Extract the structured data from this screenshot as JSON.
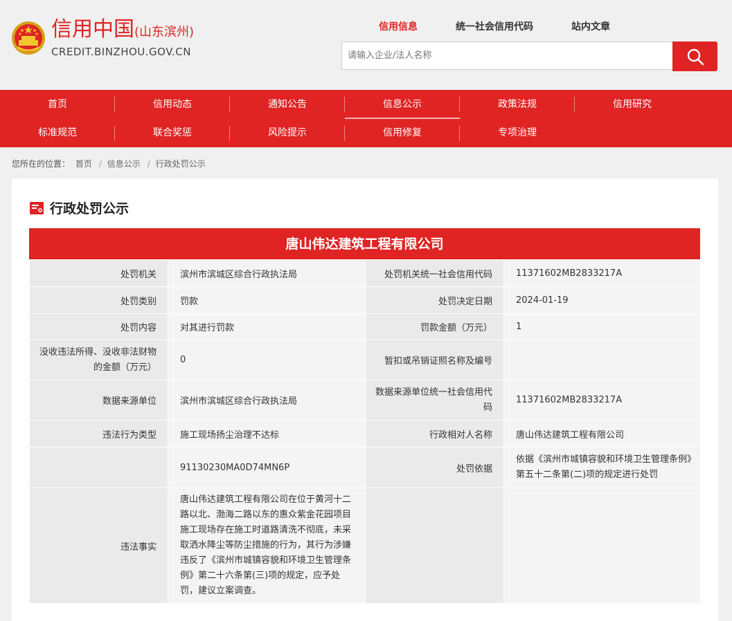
{
  "header": {
    "logo_main": "信用中国",
    "logo_region": "(山东滨州)",
    "logo_domain": "CREDIT.BINZHOU.GOV.CN",
    "top_tabs": [
      {
        "label": "信用信息",
        "active": true
      },
      {
        "label": "统一社会信用代码",
        "active": false
      },
      {
        "label": "站内文章",
        "active": false
      }
    ],
    "search_placeholder": "请输入企业/法人名称"
  },
  "nav": {
    "row1": [
      "首页",
      "信用动态",
      "通知公告",
      "信息公示",
      "政策法规",
      "信用研究"
    ],
    "row2": [
      "标准规范",
      "联合奖惩",
      "风险提示",
      "信用修复",
      "专项治理"
    ],
    "active": "信息公示"
  },
  "breadcrumb": {
    "prefix": "您所在的位置：",
    "items": [
      "首页",
      "信息公示",
      "行政处罚公示"
    ]
  },
  "panel": {
    "title": "行政处罚公示",
    "company": "唐山伟达建筑工程有限公司",
    "rows": [
      {
        "l1": "处罚机关",
        "v1": "滨州市滨城区综合行政执法局",
        "l2": "处罚机关统一社会信用代码",
        "v2": "11371602MB2833217A"
      },
      {
        "l1": "处罚类别",
        "v1": "罚款",
        "l2": "处罚决定日期",
        "v2": "2024-01-19"
      },
      {
        "l1": "处罚内容",
        "v1": "对其进行罚款",
        "l2": "罚款金额（万元）",
        "v2": "1"
      },
      {
        "l1": "没收违法所得、没收非法财物的金额（万元）",
        "v1": "0",
        "l2": "暂扣或吊销证照名称及编号",
        "v2": ""
      },
      {
        "l1": "数据来源单位",
        "v1": "滨州市滨城区综合行政执法局",
        "l2": "数据来源单位统一社会信用代码",
        "v2": "11371602MB2833217A"
      },
      {
        "l1": "违法行为类型",
        "v1": "施工现场扬尘治理不达标",
        "l2": "行政相对人名称",
        "v2": "唐山伟达建筑工程有限公司"
      },
      {
        "l1": "",
        "v1": "91130230MA0D74MN6P",
        "l2": "处罚依据",
        "v2": "依据《滨州市城镇容貌和环境卫生管理条例》第五十二条第(二)项的规定进行处罚"
      },
      {
        "l1": "违法事实",
        "v1": "唐山伟达建筑工程有限公司在位于黄河十二路以北、渤海二路以东的惠众紫金花园项目施工现场存在施工时道路清洗不彻底，未采取洒水降尘等防尘措施的行为，其行为涉嫌违反了《滨州市城镇容貌和环境卫生管理条例》第二十六条第(三)项的规定，应予处罚，建议立案调查。",
        "l2": "",
        "v2": ""
      }
    ]
  },
  "colors": {
    "brand_red": "#e02323",
    "label_bg": "#eaeaea",
    "value_bg": "#f4f4f4"
  },
  "icons": [
    "national-emblem-icon",
    "search-icon",
    "document-icon"
  ]
}
